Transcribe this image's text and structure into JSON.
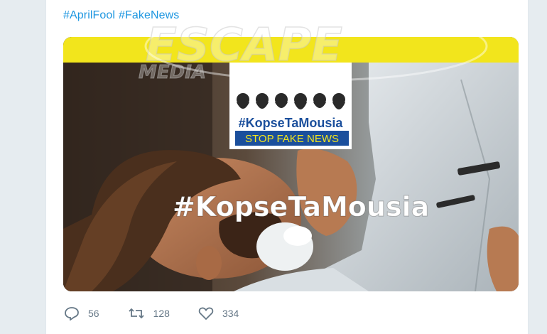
{
  "tweet": {
    "hashtags": [
      "#AprilFool",
      "#FakeNews"
    ]
  },
  "media": {
    "logo_hashtag": "#KopseTaMousia",
    "logo_banner": "STOP FAKE NEWS",
    "caption": "#KopseTaMousia",
    "accent_color": "#f2e51c",
    "banner_color": "#1b4f9c"
  },
  "actions": {
    "reply_count": "56",
    "retweet_count": "128",
    "like_count": "334"
  },
  "watermark": {
    "brand": "ESCAPE",
    "sub": "MEDIA"
  }
}
